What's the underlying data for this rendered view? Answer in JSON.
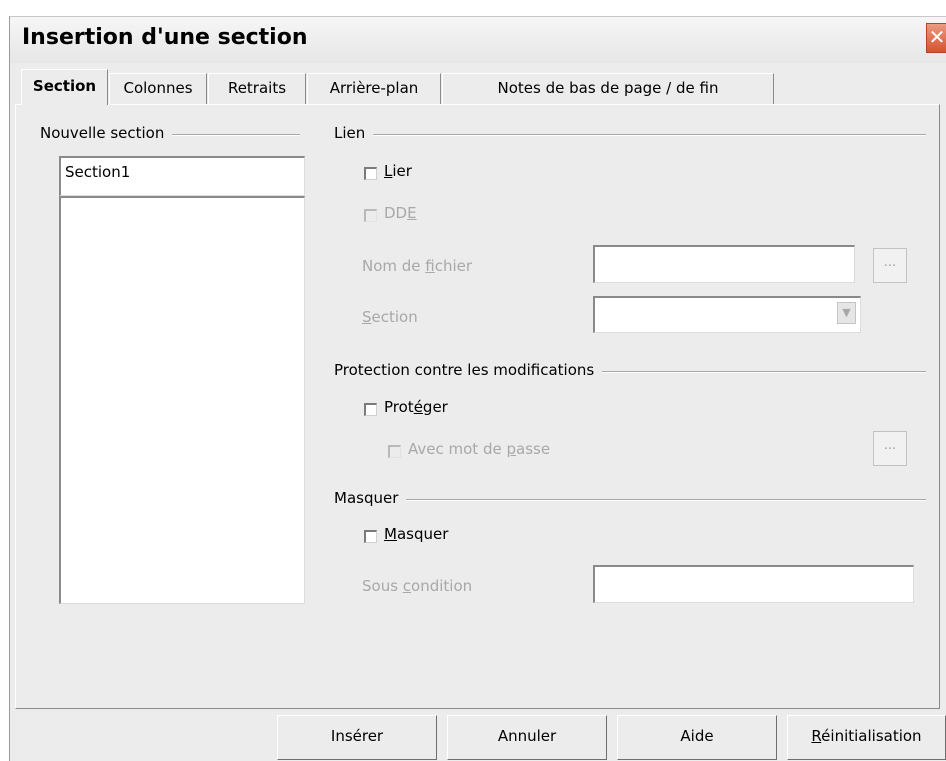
{
  "window": {
    "title": "Insertion d'une section",
    "close_glyph": "✕"
  },
  "tabs": [
    {
      "label": "Section",
      "active": true
    },
    {
      "label": "Colonnes",
      "active": false
    },
    {
      "label": "Retraits",
      "active": false
    },
    {
      "label": "Arrière-plan",
      "active": false
    },
    {
      "label": "Notes de bas de page / de fin",
      "active": false
    }
  ],
  "new_section": {
    "group_label": "Nouvelle section",
    "name_value": "Section1",
    "list_items": []
  },
  "link": {
    "group_label": "Lien",
    "lier_label_u": "L",
    "lier_label_rest": "ier",
    "lier_checked": false,
    "dde_label_a": "DD",
    "dde_label_u": "E",
    "dde_checked": false,
    "filename_label_a": "Nom de ",
    "filename_label_u": "f",
    "filename_label_b": "ichier",
    "filename_value": "",
    "browse_label": "...",
    "section_label_u": "S",
    "section_label_rest": "ection",
    "section_value": "",
    "dropdown_arrow": "▼"
  },
  "protection": {
    "group_label": "Protection contre les modifications",
    "protect_label_a": "Prot",
    "protect_label_u": "é",
    "protect_label_b": "ger",
    "protect_checked": false,
    "password_label_a": "Avec mot de ",
    "password_label_u": "p",
    "password_label_b": "asse",
    "password_checked": false,
    "password_btn_label": "..."
  },
  "hide": {
    "group_label": "Masquer",
    "hide_label_u": "M",
    "hide_label_rest": "asquer",
    "hide_checked": false,
    "condition_label_a": "Sous ",
    "condition_label_u": "c",
    "condition_label_b": "ondition",
    "condition_value": ""
  },
  "buttons": {
    "insert": "Insérer",
    "cancel": "Annuler",
    "help": "Aide",
    "reset_u": "R",
    "reset_rest": "éinitialisation"
  }
}
